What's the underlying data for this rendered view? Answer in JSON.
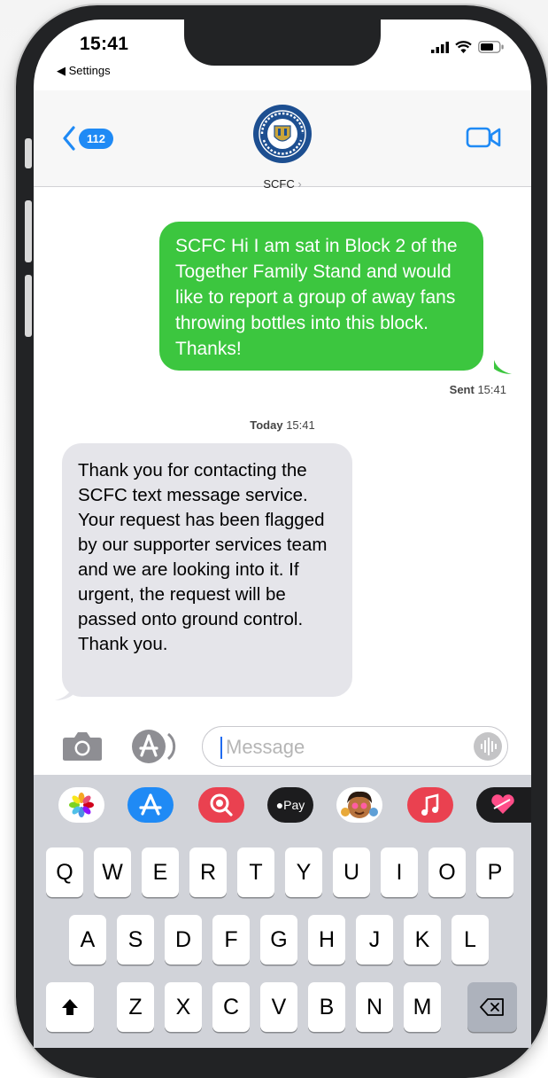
{
  "status_bar": {
    "time": "15:41",
    "back_app": "Settings"
  },
  "nav": {
    "back_count": "112",
    "contact_name": "SCFC"
  },
  "messages": {
    "outgoing": "SCFC Hi I am sat in Block 2 of the Together Family Stand and would like to report a group of away fans throwing bottles into this block. Thanks!",
    "sent_label": "Sent",
    "sent_time": "15:41",
    "divider_day": "Today",
    "divider_time": "15:41",
    "incoming": "Thank you for contacting the SCFC text message service. Your request has been flagged by our supporter services team and we are looking into it. If urgent, the request will be passed onto ground control. Thank you."
  },
  "composer": {
    "placeholder": "Message"
  },
  "app_strip": {
    "apps": [
      "photos-icon",
      "app-store-icon",
      "images-search-icon",
      "apple-pay-icon",
      "memoji-icon",
      "music-icon",
      "digital-touch-icon"
    ],
    "apple_pay_label": "Pay"
  },
  "keyboard": {
    "row1": [
      "Q",
      "W",
      "E",
      "R",
      "T",
      "Y",
      "U",
      "I",
      "O",
      "P"
    ],
    "row2": [
      "A",
      "S",
      "D",
      "F",
      "G",
      "H",
      "J",
      "K",
      "L"
    ],
    "row3": [
      "Z",
      "X",
      "C",
      "V",
      "B",
      "N",
      "M"
    ]
  },
  "colors": {
    "sent_bubble": "#3cc63f",
    "received_bubble": "#e5e5ea",
    "accent": "#1f8af5"
  }
}
